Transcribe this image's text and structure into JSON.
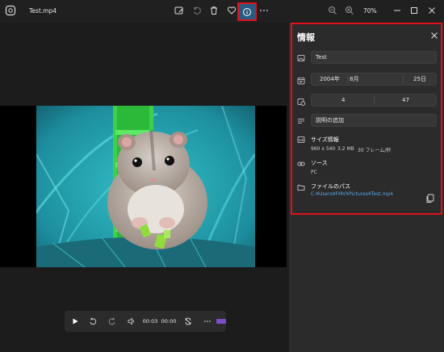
{
  "window": {
    "file_title": "Test.mp4",
    "zoom": "70%"
  },
  "player": {
    "current_time": "00:03",
    "total_time": "00:00"
  },
  "info_panel": {
    "title": "情報",
    "name_value": "Test",
    "date": {
      "year": "2004年",
      "month": "8月",
      "day": "25日"
    },
    "time": {
      "hour": "4",
      "minute": "47"
    },
    "description_placeholder": "説明の追加",
    "size_label": "サイズ情報",
    "resolution": "960 x 540",
    "file_size": "3.2 MB",
    "frame_rate": "30 フレーム/秒",
    "source_label": "ソース",
    "source_value": "PC",
    "path_label": "ファイルのパス",
    "path_value": "C:¥Users¥FMV¥Pictures¥Test.mp4"
  },
  "colors": {
    "highlight": "#e0111c",
    "link": "#58a6e8",
    "active_button": "#2a5a80"
  }
}
